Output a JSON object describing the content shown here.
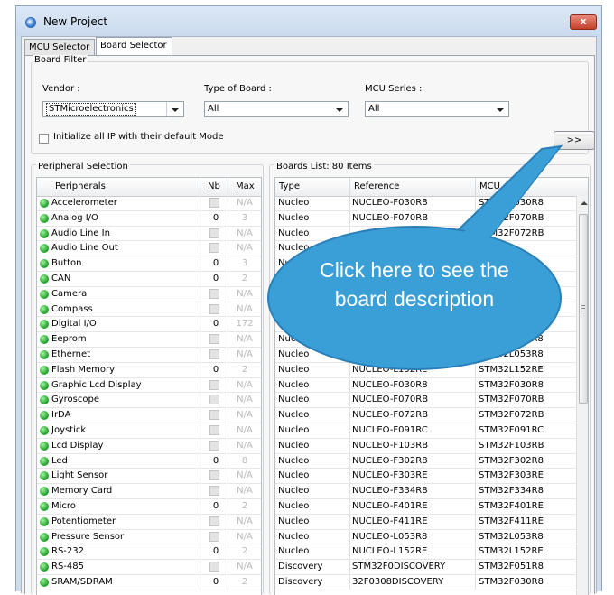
{
  "window": {
    "title": "New Project",
    "close_glyph": "x"
  },
  "tabs": [
    {
      "label": "MCU Selector"
    },
    {
      "label": "Board Selector"
    }
  ],
  "board_filter": {
    "legend": "Board Filter",
    "vendor_label": "Vendor :",
    "vendor_value": "STMicroelectronics",
    "type_label": "Type of Board :",
    "type_value": "All",
    "series_label": "MCU Series :",
    "series_value": "All",
    "init_label": "Initialize all IP with their default Mode",
    "init_checked": false,
    "details_button": ">>"
  },
  "peripheral_selection": {
    "legend": "Peripheral Selection",
    "headers": {
      "name": "Peripherals",
      "nb": "Nb",
      "max": "Max"
    },
    "rows": [
      {
        "name": "Accelerometer",
        "nb": "",
        "max": "N/A"
      },
      {
        "name": "Analog I/O",
        "nb": "0",
        "max": "3"
      },
      {
        "name": "Audio Line In",
        "nb": "",
        "max": "N/A"
      },
      {
        "name": "Audio Line Out",
        "nb": "",
        "max": "N/A"
      },
      {
        "name": "Button",
        "nb": "0",
        "max": "3"
      },
      {
        "name": "CAN",
        "nb": "0",
        "max": "2"
      },
      {
        "name": "Camera",
        "nb": "",
        "max": "N/A"
      },
      {
        "name": "Compass",
        "nb": "",
        "max": "N/A"
      },
      {
        "name": "Digital I/O",
        "nb": "0",
        "max": "172"
      },
      {
        "name": "Eeprom",
        "nb": "",
        "max": "N/A"
      },
      {
        "name": "Ethernet",
        "nb": "",
        "max": "N/A"
      },
      {
        "name": "Flash Memory",
        "nb": "0",
        "max": "2"
      },
      {
        "name": "Graphic Lcd Display",
        "nb": "",
        "max": "N/A"
      },
      {
        "name": "Gyroscope",
        "nb": "",
        "max": "N/A"
      },
      {
        "name": "IrDA",
        "nb": "",
        "max": "N/A"
      },
      {
        "name": "Joystick",
        "nb": "",
        "max": "N/A"
      },
      {
        "name": "Lcd Display",
        "nb": "",
        "max": "N/A"
      },
      {
        "name": "Led",
        "nb": "0",
        "max": "8"
      },
      {
        "name": "Light Sensor",
        "nb": "",
        "max": "N/A"
      },
      {
        "name": "Memory Card",
        "nb": "",
        "max": "N/A"
      },
      {
        "name": "Micro",
        "nb": "0",
        "max": "2"
      },
      {
        "name": "Potentiometer",
        "nb": "",
        "max": "N/A"
      },
      {
        "name": "Pressure Sensor",
        "nb": "",
        "max": "N/A"
      },
      {
        "name": "RS-232",
        "nb": "0",
        "max": "2"
      },
      {
        "name": "RS-485",
        "nb": "",
        "max": "N/A"
      },
      {
        "name": "SRAM/SDRAM",
        "nb": "0",
        "max": "2"
      }
    ]
  },
  "boards_list": {
    "legend": "Boards List: 80 Items",
    "headers": {
      "type": "Type",
      "reference": "Reference",
      "mcu": "MCU"
    },
    "rows": [
      {
        "type": "Nucleo",
        "reference": "NUCLEO-F030R8",
        "mcu": "STM32F030R8"
      },
      {
        "type": "Nucleo",
        "reference": "NUCLEO-F070RB",
        "mcu": "STM32F070RB"
      },
      {
        "type": "Nucleo",
        "reference": "",
        "mcu": "STM32F072RB"
      },
      {
        "type": "Nucleo",
        "reference": "",
        "mcu": ""
      },
      {
        "type": "Nucleo",
        "reference": "",
        "mcu": ""
      },
      {
        "type": "Nucleo",
        "reference": "",
        "mcu": ""
      },
      {
        "type": "Nucleo",
        "reference": "",
        "mcu": ""
      },
      {
        "type": "Nucleo",
        "reference": "",
        "mcu": ""
      },
      {
        "type": "Nucleo",
        "reference": "",
        "mcu": ""
      },
      {
        "type": "Nucleo",
        "reference": "",
        "mcu": "STM32L053R8"
      },
      {
        "type": "Nucleo",
        "reference": "NUCLEO-L053R8",
        "mcu": "STM32L053R8"
      },
      {
        "type": "Nucleo",
        "reference": "NUCLEO-L152RE",
        "mcu": "STM32L152RE"
      },
      {
        "type": "Nucleo",
        "reference": "NUCLEO-F030R8",
        "mcu": "STM32F030R8"
      },
      {
        "type": "Nucleo",
        "reference": "NUCLEO-F070RB",
        "mcu": "STM32F070RB"
      },
      {
        "type": "Nucleo",
        "reference": "NUCLEO-F072RB",
        "mcu": "STM32F072RB"
      },
      {
        "type": "Nucleo",
        "reference": "NUCLEO-F091RC",
        "mcu": "STM32F091RC"
      },
      {
        "type": "Nucleo",
        "reference": "NUCLEO-F103RB",
        "mcu": "STM32F103RB"
      },
      {
        "type": "Nucleo",
        "reference": "NUCLEO-F302R8",
        "mcu": "STM32F302R8"
      },
      {
        "type": "Nucleo",
        "reference": "NUCLEO-F303RE",
        "mcu": "STM32F303RE"
      },
      {
        "type": "Nucleo",
        "reference": "NUCLEO-F334R8",
        "mcu": "STM32F334R8"
      },
      {
        "type": "Nucleo",
        "reference": "NUCLEO-F401RE",
        "mcu": "STM32F401RE"
      },
      {
        "type": "Nucleo",
        "reference": "NUCLEO-F411RE",
        "mcu": "STM32F411RE"
      },
      {
        "type": "Nucleo",
        "reference": "NUCLEO-L053R8",
        "mcu": "STM32L053R8"
      },
      {
        "type": "Nucleo",
        "reference": "NUCLEO-L152RE",
        "mcu": "STM32L152RE"
      },
      {
        "type": "Discovery",
        "reference": "STM32F0DISCOVERY",
        "mcu": "STM32F051R8"
      },
      {
        "type": "Discovery",
        "reference": "32F0308DISCOVERY",
        "mcu": "STM32F030R8"
      }
    ]
  },
  "callout": {
    "text": "Click here to see the board description",
    "color": "#3a9fd6",
    "border_color": "#2a7fb8"
  },
  "colors": {
    "titlebar": "#cfdcec",
    "led_green": "#2ca834",
    "close_red": "#c5402b"
  }
}
